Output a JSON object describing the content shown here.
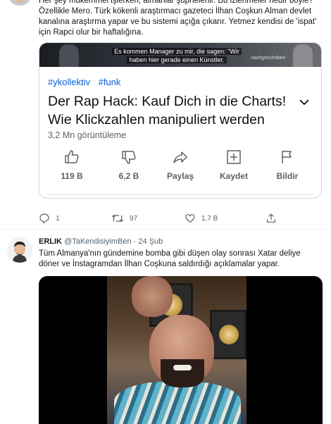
{
  "tweet1": {
    "text_lines": [
      "Her şey mükemmel işlerken, almanlar şüphelenir. Bu izlenmeler nedir böyle?",
      "Özellikle Mero. Türk kökenli araştırmacı gazeteci İlhan Coşkun Alman devlet",
      "kanalına araştırma yapar ve bu sistemi açığa çıkarır. Yetmez kendisi de 'ispat'",
      "için Rapci olur bir haftalığına."
    ],
    "card": {
      "thumbnail_caption": [
        "Es kommen Manager zu mir, die sagen: \"Wir",
        "haben hier gerade einen Künstler."
      ],
      "thumbnail_watermark": "nachgeschoben",
      "tags": [
        "#ykollektiv",
        "#funk"
      ],
      "title": "Der Rap Hack: Kauf Dich in die Charts! Wie Klickzahlen manipuliert werden",
      "views": "3,2 Mn görüntüleme",
      "actions": [
        {
          "icon": "thumbs-up-icon",
          "label": "119 B"
        },
        {
          "icon": "thumbs-down-icon",
          "label": "6,2 B"
        },
        {
          "icon": "share-icon",
          "label": "Paylaş"
        },
        {
          "icon": "save-playlist-icon",
          "label": "Kaydet"
        },
        {
          "icon": "flag-icon",
          "label": "Bildir"
        }
      ]
    },
    "stats": {
      "replies": "1",
      "retweets": "97",
      "likes": "1,7 B"
    }
  },
  "tweet2": {
    "name": "ERLIK",
    "handle": "@TaKendisiyimBen",
    "separator": "·",
    "time": "24 Şub",
    "text_lines": [
      "Tüm Almanya'nın gündemine bomba gibi düşen olay sonrası Xatar deliye",
      "döner ve İnstagramdan İlhan Coşkuna saldırdığı açıklamalar yapar."
    ]
  },
  "colors": {
    "link_blue": "#065fd4",
    "muted_text": "#536471",
    "youtube_gray": "#606060"
  }
}
